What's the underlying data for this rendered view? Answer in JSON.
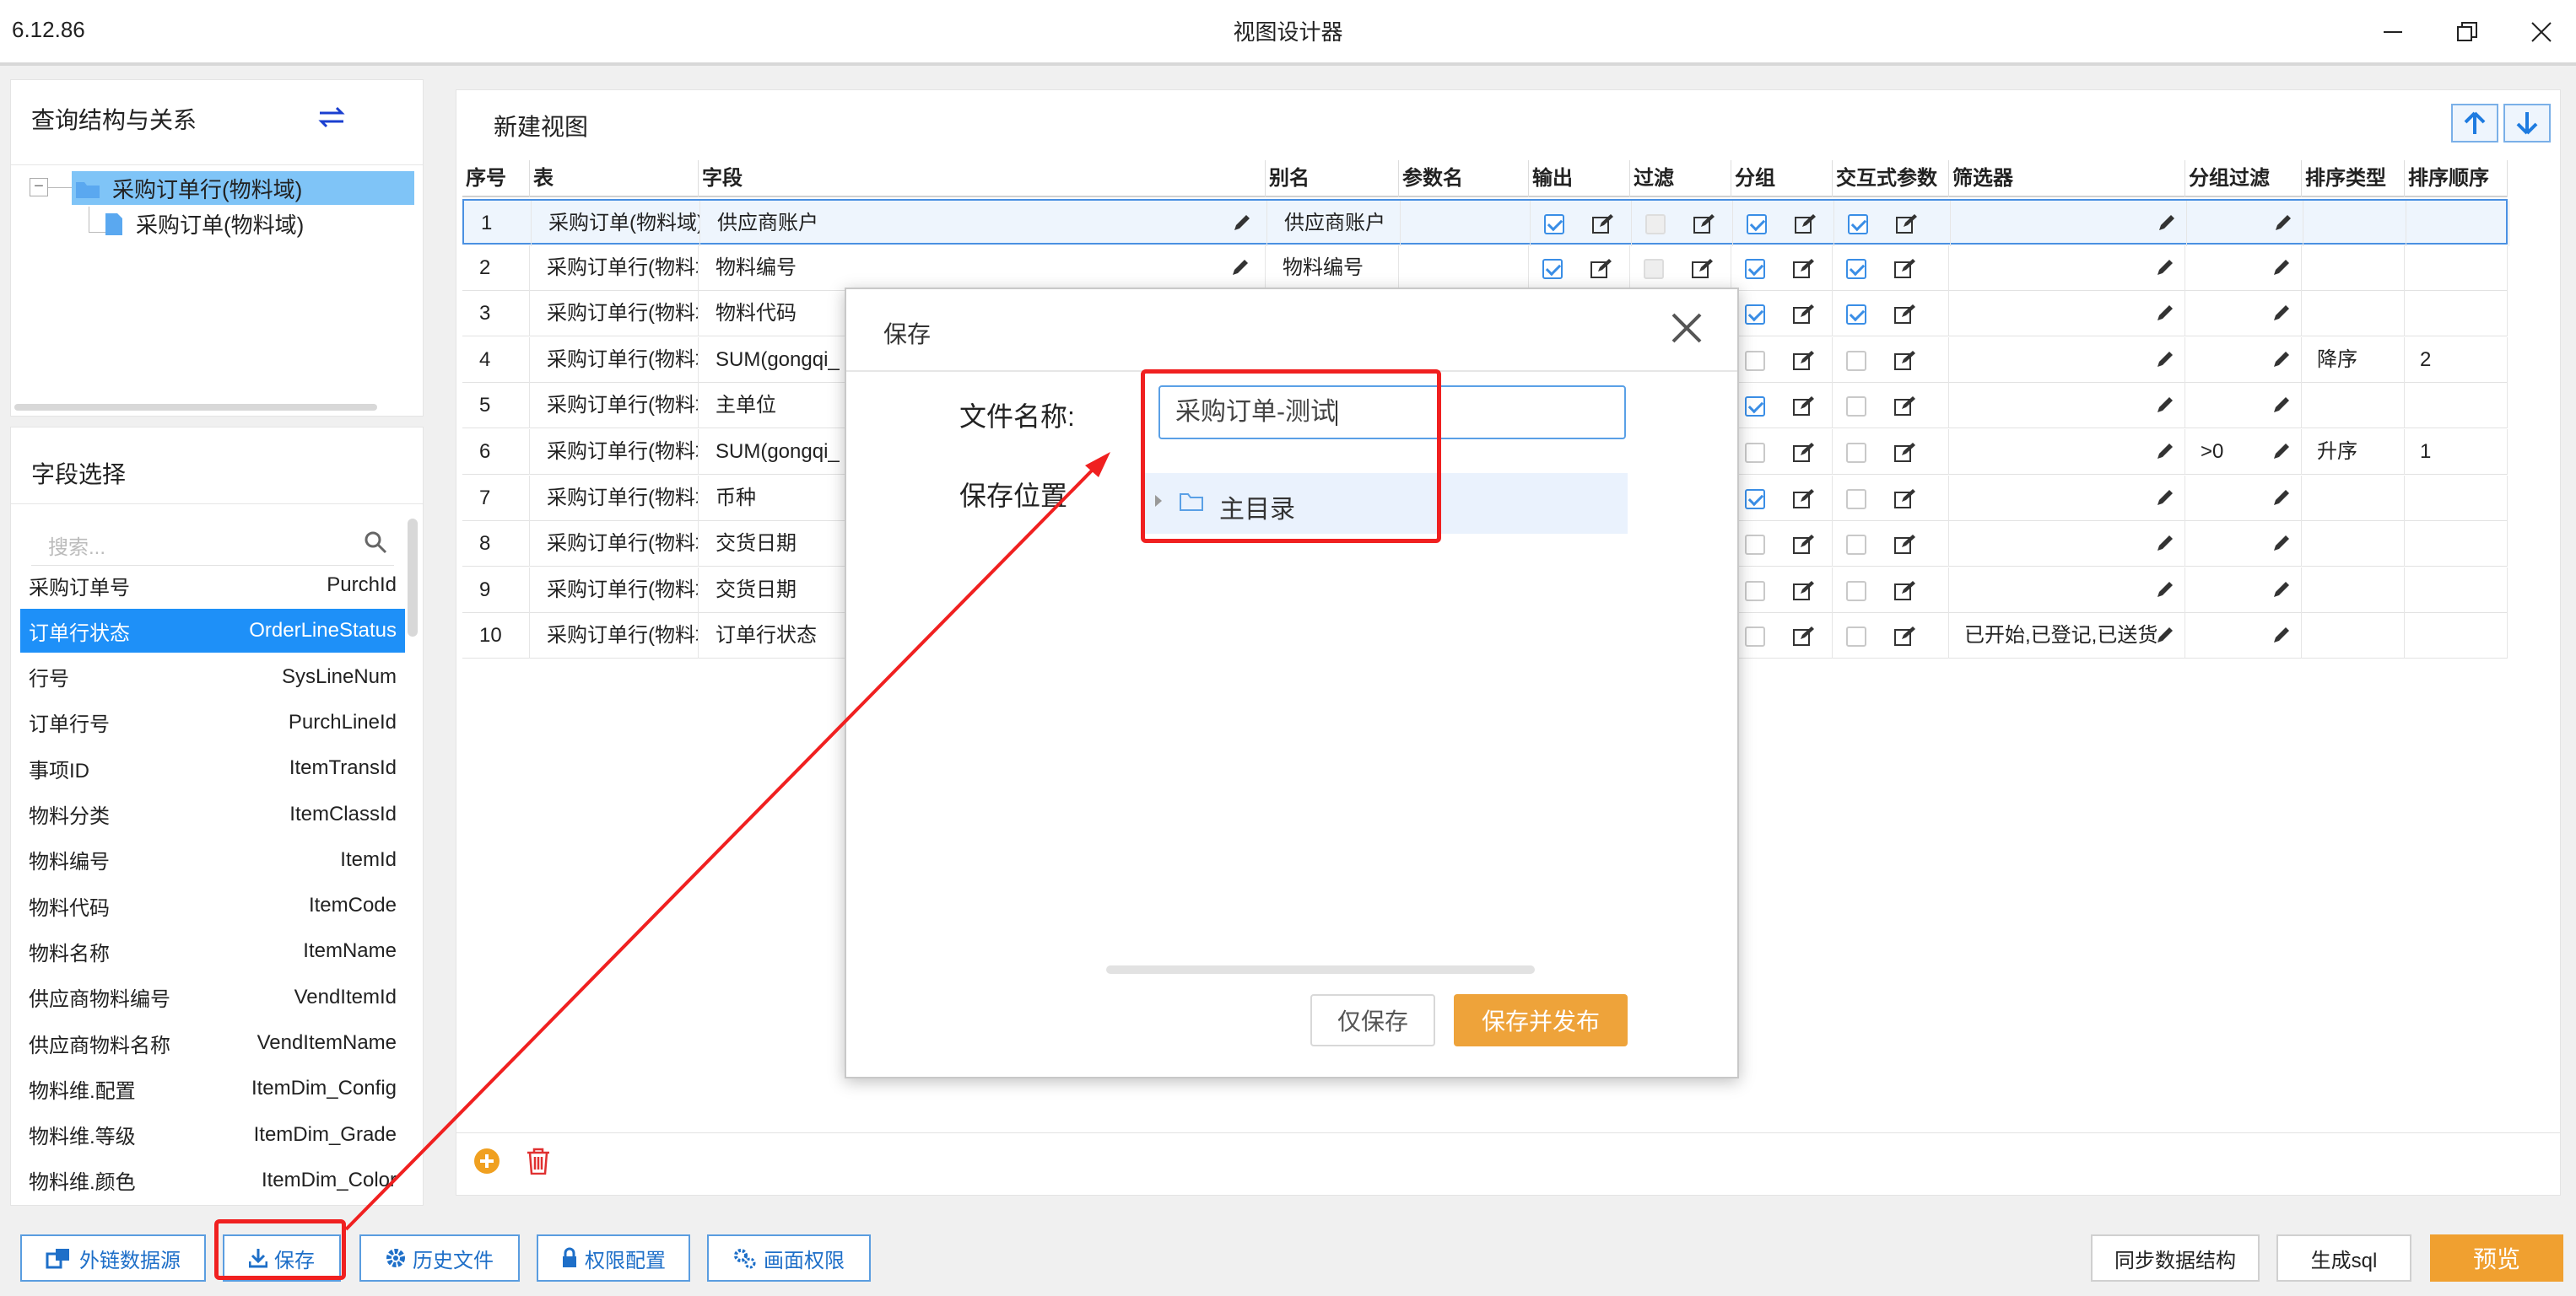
{
  "window": {
    "version": "6.12.86",
    "title": "视图设计器"
  },
  "left_top": {
    "title": "查询结构与关系",
    "tree": [
      {
        "label": "采购订单行(物料域)"
      },
      {
        "label": "采购订单(物料域)"
      }
    ]
  },
  "left_bottom": {
    "title": "字段选择",
    "search_placeholder": "搜索...",
    "fields": [
      {
        "name": "采购订单号",
        "code": "PurchId"
      },
      {
        "name": "订单行状态",
        "code": "OrderLineStatus"
      },
      {
        "name": "行号",
        "code": "SysLineNum"
      },
      {
        "name": "订单行号",
        "code": "PurchLineId"
      },
      {
        "name": "事项ID",
        "code": "ItemTransId"
      },
      {
        "name": "物料分类",
        "code": "ItemClassId"
      },
      {
        "name": "物料编号",
        "code": "ItemId"
      },
      {
        "name": "物料代码",
        "code": "ItemCode"
      },
      {
        "name": "物料名称",
        "code": "ItemName"
      },
      {
        "name": "供应商物料编号",
        "code": "VendItemId"
      },
      {
        "name": "供应商物料名称",
        "code": "VendItemName"
      },
      {
        "name": "物料维.配置",
        "code": "ItemDim_Config"
      },
      {
        "name": "物料维.等级",
        "code": "ItemDim_Grade"
      },
      {
        "name": "物料维.颜色",
        "code": "ItemDim_Color"
      }
    ]
  },
  "main": {
    "view_title": "新建视图",
    "columns": [
      "序号",
      "表",
      "字段",
      "别名",
      "参数名",
      "输出",
      "过滤",
      "分组",
      "交互式参数",
      "筛选器",
      "分组过滤",
      "排序类型",
      "排序顺序"
    ],
    "rows": [
      {
        "no": "1",
        "table": "采购订单(物料域)",
        "field": "供应商账户",
        "alias": "供应商账户",
        "output": true,
        "filter": false,
        "group": true,
        "interactive": true,
        "filter_text": "",
        "group_filter": "",
        "sort_type": "",
        "sort_order": ""
      },
      {
        "no": "2",
        "table": "采购订单行(物料域)",
        "field": "物料编号",
        "alias": "物料编号",
        "output": true,
        "filter": false,
        "group": true,
        "interactive": true,
        "filter_text": "",
        "group_filter": "",
        "sort_type": "",
        "sort_order": ""
      },
      {
        "no": "3",
        "table": "采购订单行(物料域)",
        "field": "物料代码",
        "alias": "",
        "output": true,
        "filter": false,
        "group": true,
        "interactive": true,
        "filter_text": "",
        "group_filter": "",
        "sort_type": "",
        "sort_order": ""
      },
      {
        "no": "4",
        "table": "采购订单行(物料域)",
        "field": "SUM(gongqi_",
        "alias": "",
        "output": true,
        "filter": false,
        "group": false,
        "interactive": false,
        "filter_text": "",
        "group_filter": "",
        "sort_type": "降序",
        "sort_order": "2"
      },
      {
        "no": "5",
        "table": "采购订单行(物料域)",
        "field": "主单位",
        "alias": "",
        "output": true,
        "filter": false,
        "group": true,
        "interactive": false,
        "filter_text": "",
        "group_filter": "",
        "sort_type": "",
        "sort_order": ""
      },
      {
        "no": "6",
        "table": "采购订单行(物料域)",
        "field": "SUM(gongqi_",
        "alias": "",
        "output": true,
        "filter": false,
        "group": false,
        "interactive": false,
        "filter_text": "",
        "group_filter": ">0",
        "sort_type": "升序",
        "sort_order": "1"
      },
      {
        "no": "7",
        "table": "采购订单行(物料域)",
        "field": "币种",
        "alias": "",
        "output": true,
        "filter": false,
        "group": true,
        "interactive": false,
        "filter_text": "",
        "group_filter": "",
        "sort_type": "",
        "sort_order": ""
      },
      {
        "no": "8",
        "table": "采购订单行(物料域)",
        "field": "交货日期",
        "alias": "",
        "output": true,
        "filter": false,
        "group": false,
        "interactive": false,
        "filter_text": "",
        "group_filter": "",
        "sort_type": "",
        "sort_order": ""
      },
      {
        "no": "9",
        "table": "采购订单行(物料域)",
        "field": "交货日期",
        "alias": "",
        "output": true,
        "filter": false,
        "group": false,
        "interactive": false,
        "filter_text": "",
        "group_filter": "",
        "sort_type": "",
        "sort_order": ""
      },
      {
        "no": "10",
        "table": "采购订单行(物料域)",
        "field": "订单行状态",
        "alias": "",
        "output": true,
        "filter": false,
        "group": false,
        "interactive": false,
        "filter_text": "已开始,已登记,已送货",
        "group_filter": "",
        "sort_type": "",
        "sort_order": ""
      }
    ]
  },
  "toolbar": {
    "external_source": "外链数据源",
    "save": "保存",
    "history": "历史文件",
    "permission": "权限配置",
    "screen_permission": "画面权限",
    "sync": "同步数据结构",
    "gen_sql": "生成sql",
    "preview": "预览"
  },
  "dialog": {
    "title": "保存",
    "file_name_label": "文件名称:",
    "file_name_value": "采购订单-测试",
    "location_label": "保存位置",
    "root_dir": "主目录",
    "save_only": "仅保存",
    "save_publish": "保存并发布"
  },
  "colors": {
    "accent": "#1e90f8",
    "primary_button": "#f0a030",
    "highlight": "#f02020"
  }
}
